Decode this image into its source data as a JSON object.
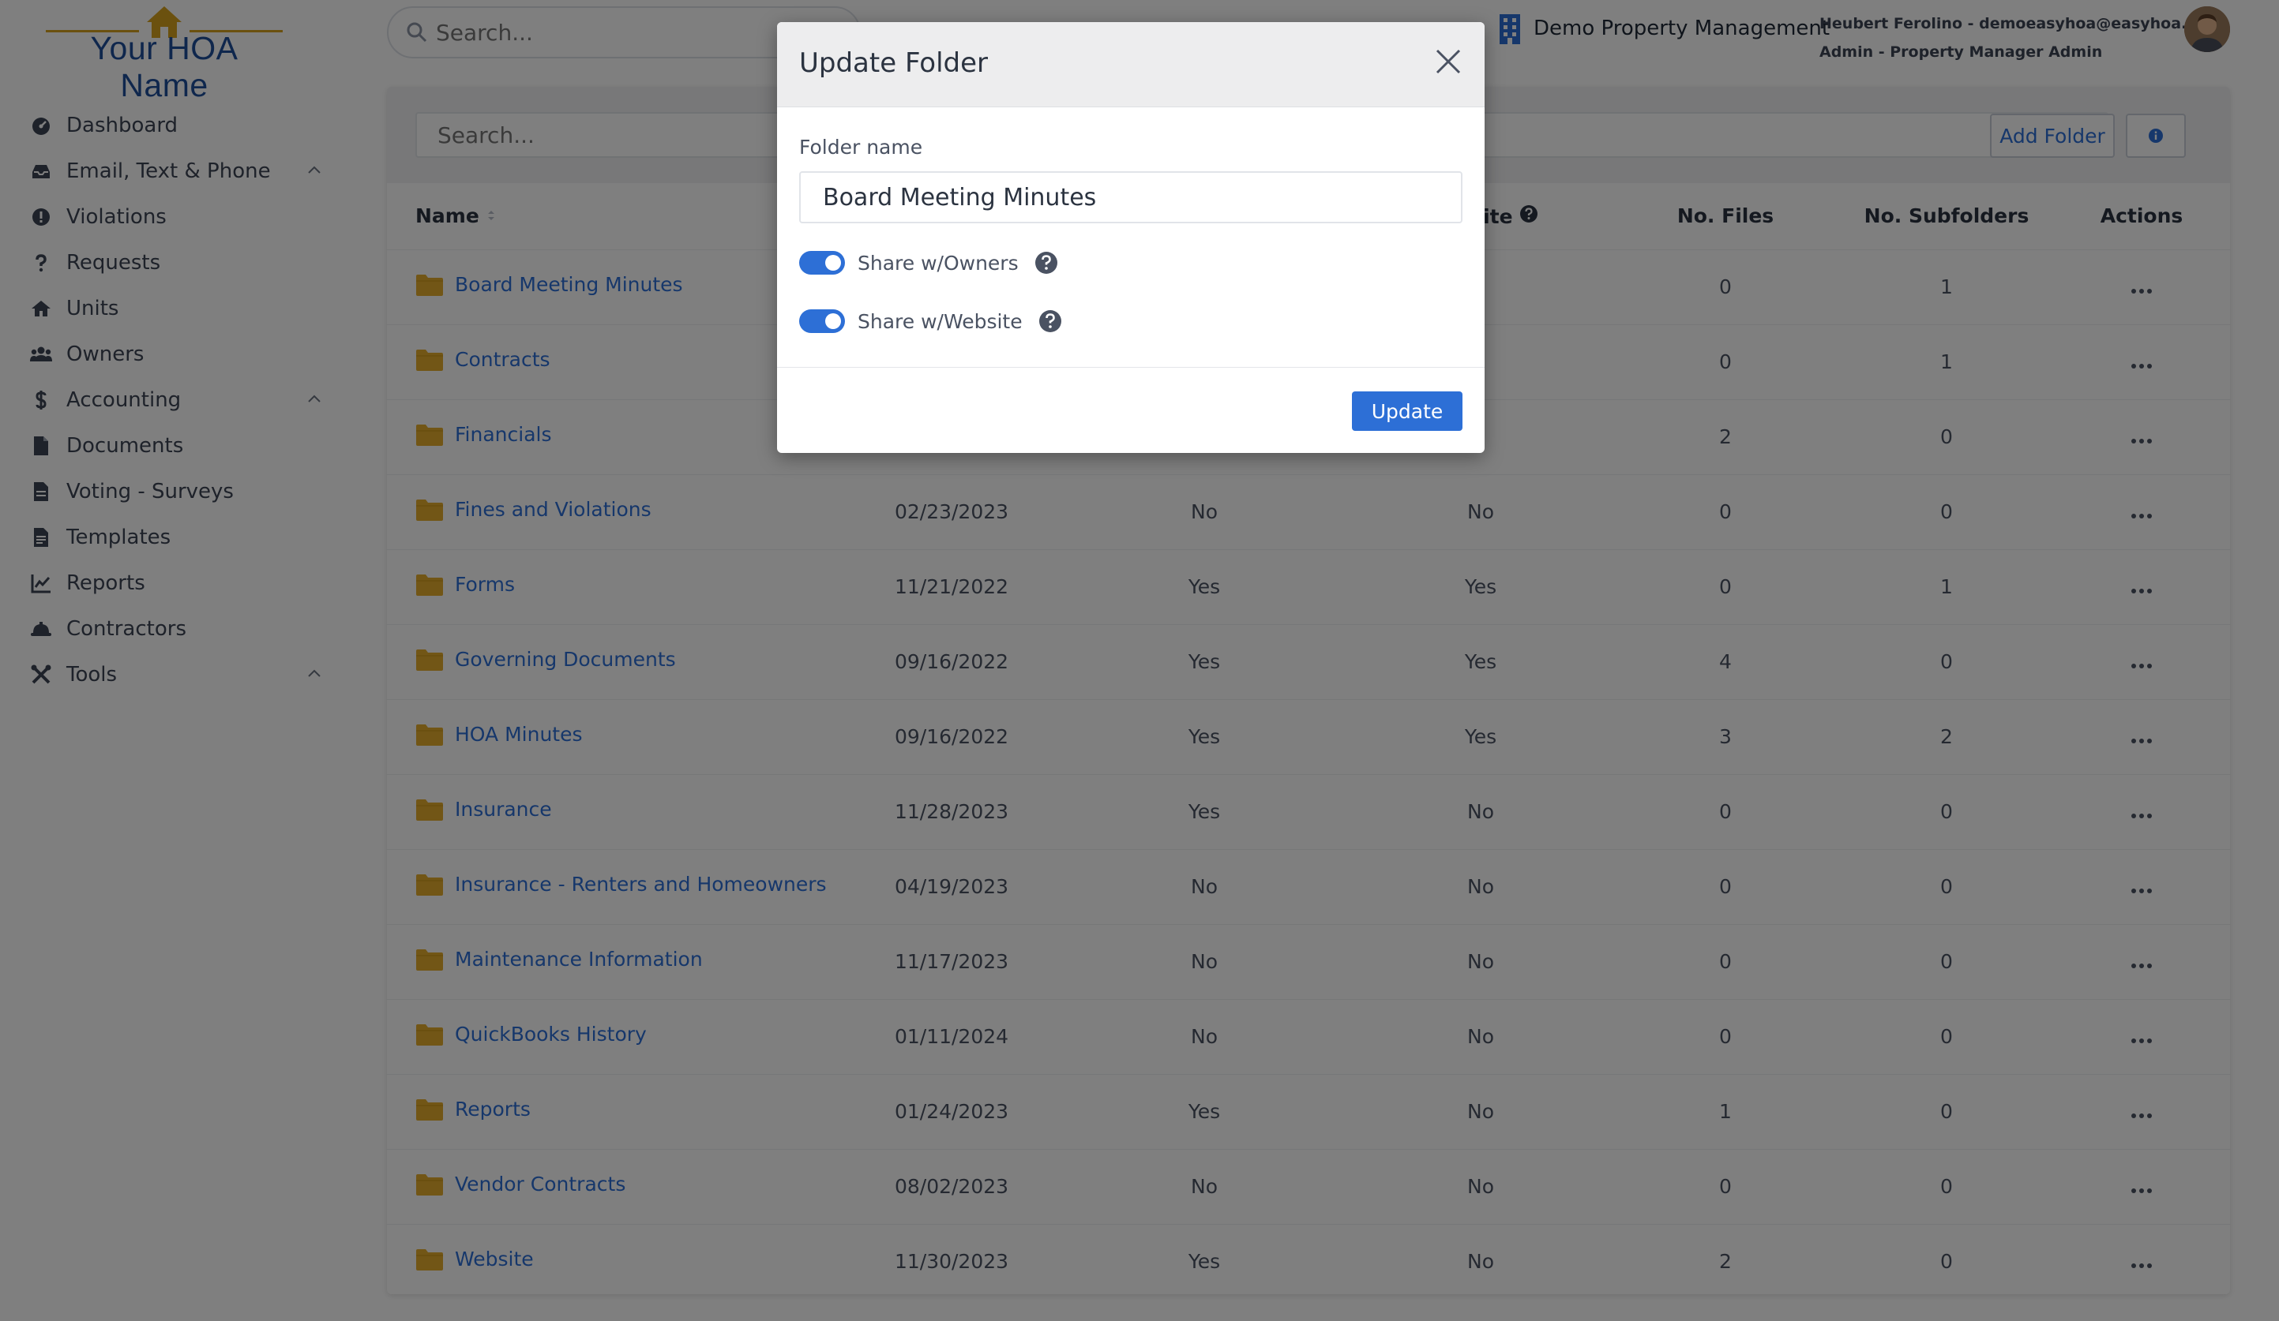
{
  "brand": {
    "name": "Your HOA Name",
    "color": "#1f4e9b",
    "accent": "#d7a21f"
  },
  "sidebar": {
    "items": [
      {
        "label": "Dashboard",
        "icon": "gauge-icon",
        "expandable": false
      },
      {
        "label": "Email, Text & Phone",
        "icon": "inbox-icon",
        "expandable": true
      },
      {
        "label": "Violations",
        "icon": "exclamation-circle-icon",
        "expandable": false
      },
      {
        "label": "Requests",
        "icon": "question-icon",
        "expandable": false
      },
      {
        "label": "Units",
        "icon": "home-icon",
        "expandable": false
      },
      {
        "label": "Owners",
        "icon": "users-icon",
        "expandable": false
      },
      {
        "label": "Accounting",
        "icon": "dollar-icon",
        "expandable": true
      },
      {
        "label": "Documents",
        "icon": "file-icon",
        "expandable": false
      },
      {
        "label": "Voting - Surveys",
        "icon": "ballot-icon",
        "expandable": false
      },
      {
        "label": "Templates",
        "icon": "file-text-icon",
        "expandable": false
      },
      {
        "label": "Reports",
        "icon": "line-chart-icon",
        "expandable": false
      },
      {
        "label": "Contractors",
        "icon": "hard-hat-icon",
        "expandable": false
      },
      {
        "label": "Tools",
        "icon": "tools-icon",
        "expandable": true
      }
    ]
  },
  "topbar": {
    "search_placeholder": "Search...",
    "company": "Demo Property Management",
    "user_line1": "Heubert Ferolino - demoeasyhoa@easyhoa.com",
    "user_line2": "Admin - Property Manager Admin"
  },
  "toolbar": {
    "search_placeholder": "Search...",
    "add_label": "Add Folder"
  },
  "table": {
    "columns": [
      "Name",
      "",
      "",
      "Website",
      "No. Files",
      "No. Subfolders",
      "Actions"
    ],
    "rows": [
      {
        "name": "Board Meeting Minutes",
        "date": "",
        "owners": "",
        "website": "",
        "files": "0",
        "subfolders": "1"
      },
      {
        "name": "Contracts",
        "date": "",
        "owners": "",
        "website": "",
        "files": "0",
        "subfolders": "1"
      },
      {
        "name": "Financials",
        "date": "",
        "owners": "",
        "website": "",
        "files": "2",
        "subfolders": "0"
      },
      {
        "name": "Fines and Violations",
        "date": "02/23/2023",
        "owners": "No",
        "website": "No",
        "files": "0",
        "subfolders": "0"
      },
      {
        "name": "Forms",
        "date": "11/21/2022",
        "owners": "Yes",
        "website": "Yes",
        "files": "0",
        "subfolders": "1"
      },
      {
        "name": "Governing Documents",
        "date": "09/16/2022",
        "owners": "Yes",
        "website": "Yes",
        "files": "4",
        "subfolders": "0"
      },
      {
        "name": "HOA Minutes",
        "date": "09/16/2022",
        "owners": "Yes",
        "website": "Yes",
        "files": "3",
        "subfolders": "2"
      },
      {
        "name": "Insurance",
        "date": "11/28/2023",
        "owners": "Yes",
        "website": "No",
        "files": "0",
        "subfolders": "0"
      },
      {
        "name": "Insurance - Renters and Homeowners",
        "date": "04/19/2023",
        "owners": "No",
        "website": "No",
        "files": "0",
        "subfolders": "0"
      },
      {
        "name": "Maintenance Information",
        "date": "11/17/2023",
        "owners": "No",
        "website": "No",
        "files": "0",
        "subfolders": "0"
      },
      {
        "name": "QuickBooks History",
        "date": "01/11/2024",
        "owners": "No",
        "website": "No",
        "files": "0",
        "subfolders": "0"
      },
      {
        "name": "Reports",
        "date": "01/24/2023",
        "owners": "Yes",
        "website": "No",
        "files": "1",
        "subfolders": "0"
      },
      {
        "name": "Vendor Contracts",
        "date": "08/02/2023",
        "owners": "No",
        "website": "No",
        "files": "0",
        "subfolders": "0"
      },
      {
        "name": "Website",
        "date": "11/30/2023",
        "owners": "Yes",
        "website": "No",
        "files": "2",
        "subfolders": "0"
      }
    ]
  },
  "modal": {
    "title": "Update Folder",
    "name_label": "Folder name",
    "name_value": "Board Meeting Minutes",
    "share_owners_label": "Share w/Owners",
    "share_owners_on": true,
    "share_website_label": "Share w/Website",
    "share_website_on": true,
    "update_label": "Update"
  },
  "colors": {
    "primary": "#2d6fd6",
    "folder": "#e4ac2c",
    "overlay": "rgba(0,0,0,0.5)"
  }
}
